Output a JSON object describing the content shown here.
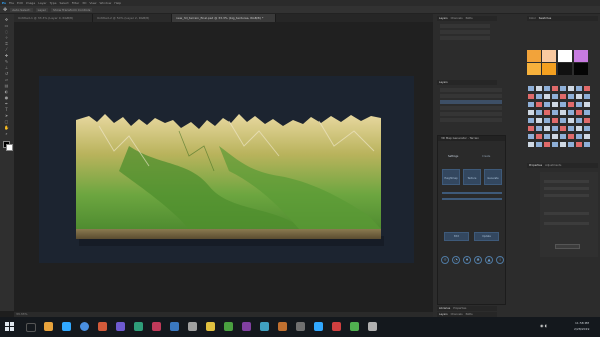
{
  "menubar": {
    "items": [
      "Ps",
      "File",
      "Edit",
      "Image",
      "Layer",
      "Type",
      "Select",
      "Filter",
      "3D",
      "View",
      "Window",
      "Help"
    ]
  },
  "options_bar": {
    "items": [
      "Auto-Select:",
      "Layer",
      "Show Transform Controls"
    ]
  },
  "document_tabs": [
    {
      "label": "Untitled-1 @ 33.3% (Layer 0, RGB/8)",
      "active": false
    },
    {
      "label": "Untitled-2 @ 50% (Layer 2, RGB/8)",
      "active": false
    },
    {
      "label": "new_3d_terrain_final.psd @ 33.3% (big_textures, RGB/8) *",
      "active": true
    }
  ],
  "status_bar": {
    "zoom": "33.33%"
  },
  "panels": {
    "top_tabs": [
      "Layers",
      "Channels",
      "Paths"
    ],
    "adjust_tabs": [
      "Color",
      "Swatches"
    ],
    "properties_tabs": [
      "Properties",
      "Adjustments"
    ],
    "layers_label": "Layers",
    "bottom_tabs": [
      "Libraries",
      "Properties"
    ],
    "bottom_tabs2": [
      "Layers",
      "Channels",
      "Paths"
    ]
  },
  "plugin": {
    "title": "3D Map Generator - Terrain",
    "tabs": [
      "Settings",
      "Create"
    ],
    "buttons_row1": [
      "Heightmap",
      "Texture",
      "Generate"
    ],
    "buttons_row2": [
      "Edit",
      "Update"
    ],
    "icons": [
      "sun-icon",
      "light-icon",
      "drop-icon",
      "tree-icon",
      "mountain-icon",
      "info-icon"
    ]
  },
  "taskbar": {
    "time": "11:58 PM",
    "date": "2/28/2019"
  },
  "colors": {
    "canvas_bg": "#1c2430",
    "ui_bg": "#2c2c2c",
    "accent": "#31a8ff",
    "terrain_low": "#5b9a37",
    "terrain_high": "#d6c27a"
  },
  "swatches_top": [
    "#f2a33a",
    "#f9c9a0",
    "#ffffff",
    "#c77be0",
    "#f7b13c",
    "#f4a020",
    "#111111",
    "#050505"
  ]
}
